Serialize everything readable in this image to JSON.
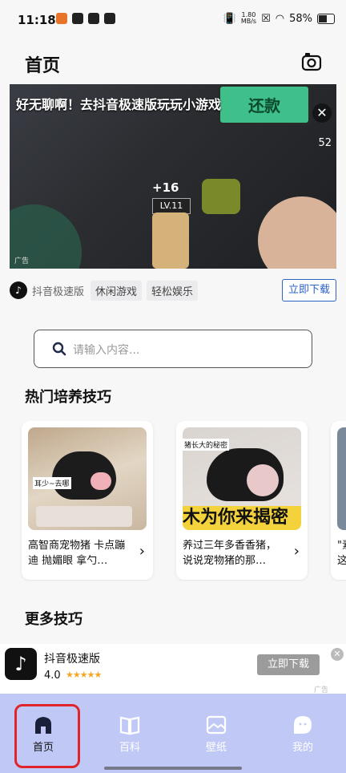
{
  "status_bar": {
    "time": "11:18",
    "net_speed_value": "1.80",
    "net_speed_unit": "MB/s",
    "battery": "58%"
  },
  "header": {
    "title": "首页",
    "camera_icon": "camera-icon"
  },
  "video_ad": {
    "headline": "好无聊啊！去抖音极速版玩玩小游戏",
    "ad_tag": "广告",
    "game_button_text": "还款",
    "game_level": "LV.11",
    "game_plus": "+16",
    "game_number": "52"
  },
  "ad_meta": {
    "app_name": "抖音极速版",
    "tags": [
      "休闲游戏",
      "轻松娱乐"
    ],
    "download_label": "立即下载",
    "accent_color": "#2b62c4"
  },
  "search": {
    "placeholder": "请输入内容..."
  },
  "sections": {
    "hot": "热门培养技巧",
    "more": "更多技巧"
  },
  "hot_cards": [
    {
      "text": "高智商宠物猪 卡点蹦迪 抛媚眼 拿勺…",
      "caption": "耳少~去哪",
      "image": "pig-photo"
    },
    {
      "text": "养过三年多香香猪，说说宠物猪的那…",
      "caption": "猪长大的秘密",
      "banner": "木为你来揭密",
      "image": "pig-photo"
    },
    {
      "text": "\"素这",
      "image": "pig-photo"
    }
  ],
  "bottom_ad": {
    "app_name": "抖音极速版",
    "rating": "4.0",
    "stars": "★★★★★",
    "download_label": "立即下载",
    "ad_tag": "广告"
  },
  "tabbar": {
    "items": [
      {
        "label": "首页",
        "icon": "home-icon"
      },
      {
        "label": "百科",
        "icon": "book-icon"
      },
      {
        "label": "壁纸",
        "icon": "wallpaper-icon"
      },
      {
        "label": "我的",
        "icon": "profile-icon"
      }
    ],
    "active_index": 0,
    "background": "#c0c9f6",
    "highlight_color": "#e0242c"
  }
}
